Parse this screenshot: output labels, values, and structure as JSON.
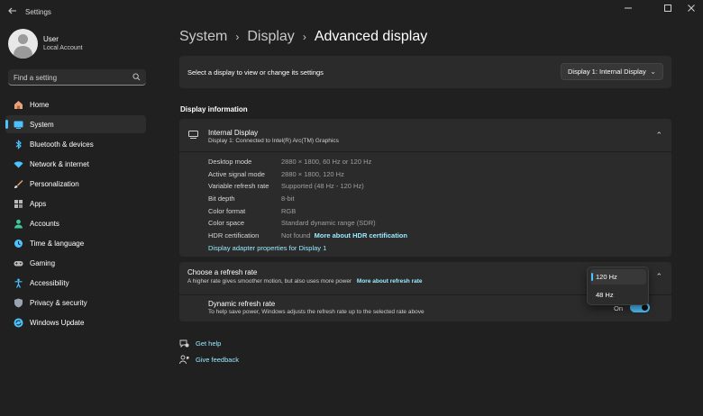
{
  "window": {
    "title": "Settings",
    "back_icon": "arrow-left-icon",
    "controls": [
      "minimize-icon",
      "maximize-icon",
      "close-icon"
    ]
  },
  "user": {
    "name": "User",
    "account": "Local Account"
  },
  "search": {
    "placeholder": "Find a setting"
  },
  "nav": [
    {
      "label": "Home",
      "icon": "home-icon",
      "color": "#e8a37c"
    },
    {
      "label": "System",
      "icon": "system-icon",
      "color": "#4cc2ff",
      "active": true
    },
    {
      "label": "Bluetooth & devices",
      "icon": "bluetooth-icon",
      "color": "#4cc2ff"
    },
    {
      "label": "Network & internet",
      "icon": "wifi-icon",
      "color": "#4cc2ff"
    },
    {
      "label": "Personalization",
      "icon": "brush-icon",
      "color": "#f0a070"
    },
    {
      "label": "Apps",
      "icon": "apps-icon",
      "color": "#b9b9b9"
    },
    {
      "label": "Accounts",
      "icon": "person-icon",
      "color": "#3fc89a"
    },
    {
      "label": "Time & language",
      "icon": "globe-clock-icon",
      "color": "#4cc2ff"
    },
    {
      "label": "Gaming",
      "icon": "gamepad-icon",
      "color": "#b9b9b9"
    },
    {
      "label": "Accessibility",
      "icon": "accessibility-icon",
      "color": "#4cc2ff"
    },
    {
      "label": "Privacy & security",
      "icon": "shield-icon",
      "color": "#9aa4b0"
    },
    {
      "label": "Windows Update",
      "icon": "update-icon",
      "color": "#4cc2ff"
    }
  ],
  "breadcrumb": {
    "items": [
      "System",
      "Display",
      "Advanced display"
    ]
  },
  "display_select": {
    "label": "Select a display to view or change its settings",
    "value": "Display 1: Internal Display"
  },
  "display_info": {
    "section_title": "Display information",
    "title": "Internal Display",
    "subtitle": "Display 1: Connected to Intel(R) Arc(TM) Graphics",
    "rows": [
      {
        "key": "Desktop mode",
        "value": "2880 × 1800, 60 Hz or 120 Hz"
      },
      {
        "key": "Active signal mode",
        "value": "2880 × 1800, 120 Hz"
      },
      {
        "key": "Variable refresh rate",
        "value": "Supported (48 Hz - 120 Hz)"
      },
      {
        "key": "Bit depth",
        "value": "8-bit"
      },
      {
        "key": "Color format",
        "value": "RGB"
      },
      {
        "key": "Color space",
        "value": "Standard dynamic range (SDR)"
      }
    ],
    "hdr": {
      "key": "HDR certification",
      "value": "Not found",
      "link": "More about HDR certification"
    },
    "adapter_link": "Display adapter properties for Display 1"
  },
  "refresh": {
    "title": "Choose a refresh rate",
    "subtitle": "A higher rate gives smoother motion, but also uses more power",
    "link": "More about refresh rate",
    "options": [
      "120 Hz",
      "48 Hz"
    ],
    "selected": "120 Hz",
    "dynamic": {
      "title": "Dynamic refresh rate",
      "subtitle": "To help save power, Windows adjusts the refresh rate up to the selected rate above",
      "state": "On"
    }
  },
  "help": {
    "get_help": "Get help",
    "feedback": "Give feedback"
  },
  "colors": {
    "accent": "#4cc2ff",
    "link": "#99ebff",
    "background": "#202020",
    "card": "#2b2b2b"
  }
}
